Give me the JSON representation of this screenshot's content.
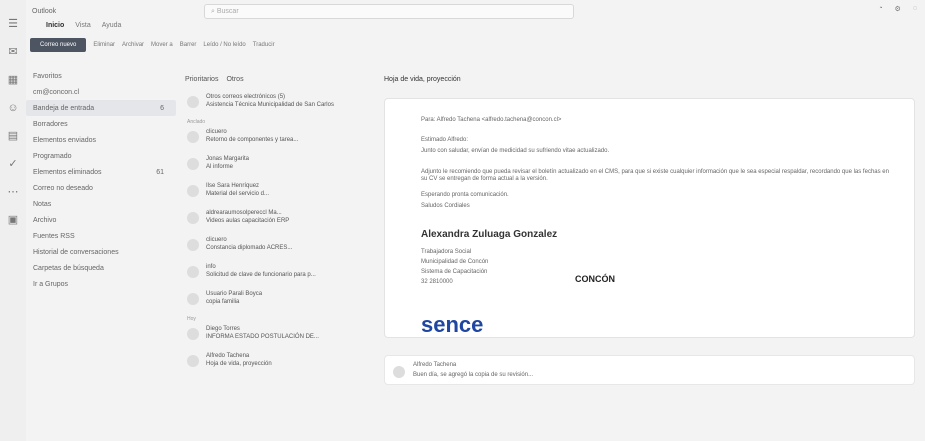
{
  "app": {
    "title": "Outlook",
    "search_placeholder": "Buscar"
  },
  "menu": {
    "items": [
      "Inicio",
      "Vista",
      "Ayuda"
    ]
  },
  "ribbon": {
    "new_mail": "Correo nuevo",
    "delete": "Eliminar",
    "archive": "Archivar",
    "move": "Mover a",
    "sweep": "Barrer",
    "read_unread": "Leído / No leído",
    "translate": "Traducir"
  },
  "sidebar": {
    "favorites": "Favoritos",
    "account": "cm@concon.cl",
    "items": [
      {
        "label": "Bandeja de entrada",
        "count": "6"
      },
      {
        "label": "Borradores",
        "count": ""
      },
      {
        "label": "Elementos enviados",
        "count": ""
      },
      {
        "label": "Programado",
        "count": ""
      },
      {
        "label": "Elementos eliminados",
        "count": "61"
      },
      {
        "label": "Correo no deseado",
        "count": ""
      },
      {
        "label": "Notas",
        "count": ""
      },
      {
        "label": "Archivo",
        "count": ""
      },
      {
        "label": "Fuentes RSS",
        "count": ""
      },
      {
        "label": "Historial de conversaciones",
        "count": ""
      },
      {
        "label": "Carpetas de búsqueda",
        "count": ""
      },
      {
        "label": "Ir a Grupos",
        "count": ""
      }
    ]
  },
  "list": {
    "tabs": [
      "Prioritarios",
      "Otros"
    ],
    "heading": "Hoja de vida, proyección",
    "pinned": "Anclado",
    "today": "Hoy",
    "messages": [
      {
        "sender": "Otros correos electrónicos (5)",
        "subject": "Asistencia Técnica Municipalidad de San Carlos"
      },
      {
        "sender": "clicuero",
        "subject": "Retorno de componentes y tarea..."
      },
      {
        "sender": "Jonas Margarita",
        "subject": "Al informe"
      },
      {
        "sender": "Ilse Sara Henríquez",
        "subject": "Material del servicio d..."
      },
      {
        "sender": "aldrearaumosolpereccl Ma...",
        "subject": "Videos aulas capacitación ERP"
      },
      {
        "sender": "clicuero",
        "subject": "Constancia diplomado ACRES..."
      },
      {
        "sender": "info",
        "subject": "Solicitud de clave de funcionario para p..."
      },
      {
        "sender": "Usuario Parali Boyca",
        "subject": "copia familia"
      },
      {
        "sender": "Diego Torres",
        "subject": "INFORMA ESTADO POSTULACIÓN DE..."
      },
      {
        "sender": "Alfredo Tachena",
        "subject": "Hoja de vida, proyección"
      }
    ]
  },
  "reading": {
    "from": "Para: Alfredo Tachena <alfredo.tachena@concon.cl>",
    "body_1": "Estimado Alfredo:",
    "body_2": "Junto con saludar, envían de medicidad su sufriendo vitae actualizado.",
    "body_3": "Adjunto le recomiendo que pueda revisar el boletín actualizado en el CMS, para que si existe cualquier información que le sea especial respaldar, recordando que las fechas en su CV se entregan de forma actual a la versión.",
    "body_4": "Esperando pronta comunicación.",
    "body_5": "Saludos Cordiales",
    "signature_name": "Alexandra Zuluaga Gonzalez",
    "sig_detail_1": "Trabajadora Social",
    "sig_detail_2": "Municipalidad de Concón",
    "sig_detail_3": "Sistema de Capacitación",
    "sig_detail_4": "32 2810000",
    "concon": "CONCÓN",
    "sence": "sence",
    "reply_sender": "Alfredo Tachena",
    "reply_preview": "Buen día, se agregó la copia de su revisión..."
  }
}
